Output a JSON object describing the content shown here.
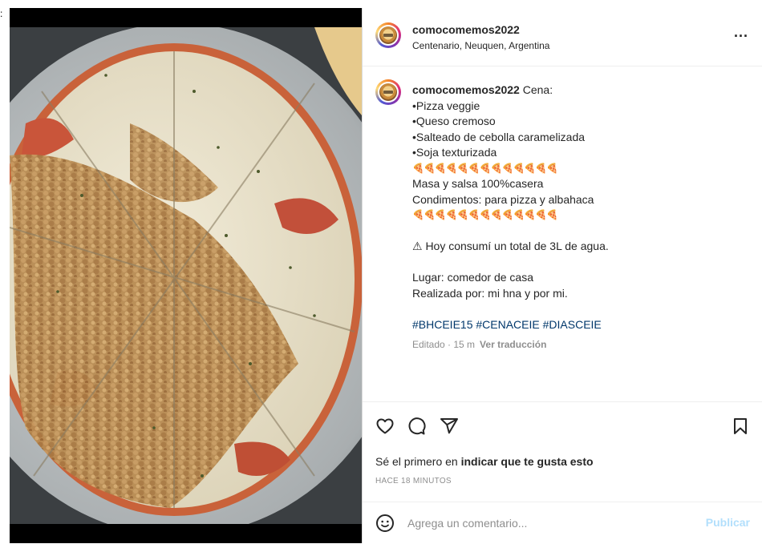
{
  "page": {
    "edge_mark": ":"
  },
  "post": {
    "username": "comocomemos2022",
    "location": "Centenario, Neuquen, Argentina",
    "more_icon": "more-options-icon",
    "more_label": "...",
    "caption": {
      "username": "comocomemos2022",
      "lines": [
        "Cena:",
        "•Pizza veggie",
        "•Queso cremoso",
        "•Salteado de cebolla caramelizada",
        "•Soja texturizada",
        "🍕🍕🍕🍕🍕🍕🍕🍕🍕🍕🍕🍕🍕",
        "Masa y salsa 100%casera",
        "Condimentos: para pizza y albahaca",
        "🍕🍕🍕🍕🍕🍕🍕🍕🍕🍕🍕🍕🍕",
        "⚠ Hoy consumí un total de 3L de agua.",
        "Lugar: comedor de casa",
        "Realizada por: mi hna y por mi.",
        "#BHCEIE15 #CENACEIE #DIASCEIE"
      ],
      "edited": "Editado · 15 m",
      "translate": "Ver traducción"
    },
    "likes_prefix": "Sé el primero en ",
    "likes_action": "indicar que te gusta esto",
    "time_ago": "HACE 18 MINUTOS",
    "comment_placeholder": "Agrega un comentario...",
    "publish_label": "Publicar",
    "icons": {
      "like": "heart-icon",
      "comment": "comment-icon",
      "share": "share-icon",
      "save": "bookmark-icon",
      "emoji": "emoji-icon"
    },
    "colors": {
      "hashtag": "#00376b",
      "publish_disabled": "#b2dffc",
      "secondary_text": "#8e8e8e"
    }
  }
}
